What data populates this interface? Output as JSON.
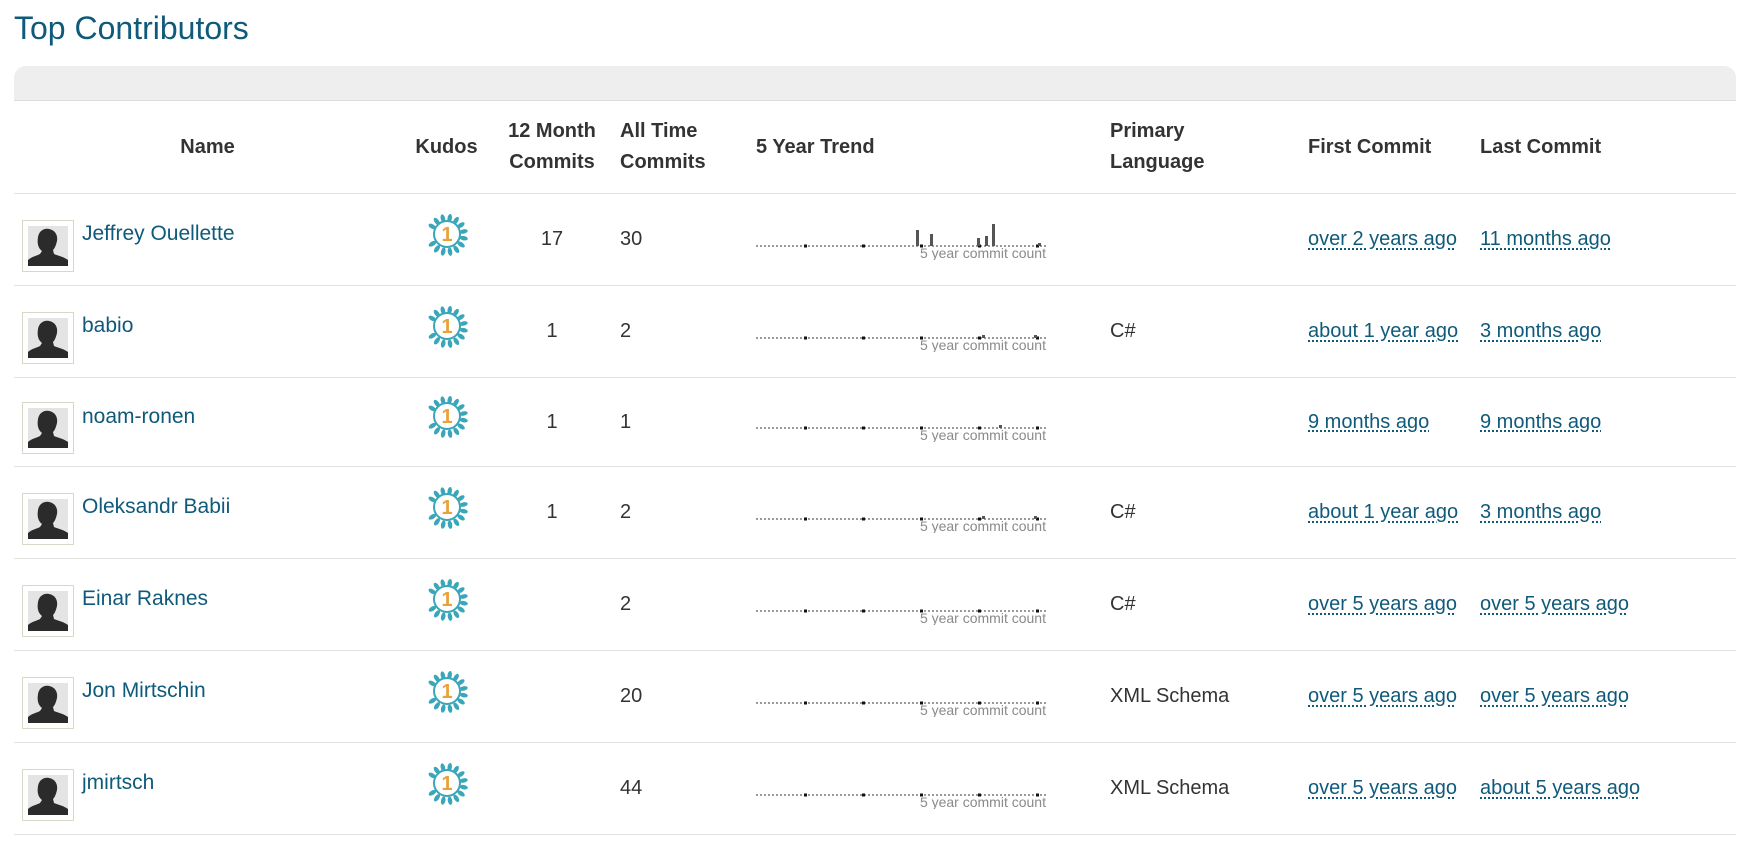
{
  "title": "Top Contributors",
  "columns": {
    "name": "Name",
    "kudos": "Kudos",
    "m12_line1": "12 Month",
    "m12_line2": "Commits",
    "all_line1": "All Time",
    "all_line2": "Commits",
    "trend": "5 Year Trend",
    "lang_line1": "Primary",
    "lang_line2": "Language",
    "first": "First Commit",
    "last": "Last Commit"
  },
  "spark_caption": "5 year commit count",
  "kudo_rank": "1",
  "colors": {
    "title": "#0f5a7a",
    "link": "#0f5a7a",
    "kudo_badge": "#3aa6b9",
    "kudo_number": "#e8a23a"
  },
  "rows": [
    {
      "name": "Jeffrey Ouellette",
      "commits_12m": "17",
      "commits_all": "30",
      "language": "",
      "first_commit": "over 2 years ago",
      "last_commit": "11 months ago"
    },
    {
      "name": "babio",
      "commits_12m": "1",
      "commits_all": "2",
      "language": "C#",
      "first_commit": "about 1 year ago",
      "last_commit": "3 months ago"
    },
    {
      "name": "noam-ronen",
      "commits_12m": "1",
      "commits_all": "1",
      "language": "",
      "first_commit": "9 months ago",
      "last_commit": "9 months ago"
    },
    {
      "name": "Oleksandr Babii",
      "commits_12m": "1",
      "commits_all": "2",
      "language": "C#",
      "first_commit": "about 1 year ago",
      "last_commit": "3 months ago"
    },
    {
      "name": "Einar Raknes",
      "commits_12m": "",
      "commits_all": "2",
      "language": "C#",
      "first_commit": "over 5 years ago",
      "last_commit": "over 5 years ago"
    },
    {
      "name": "Jon Mirtschin",
      "commits_12m": "",
      "commits_all": "20",
      "language": "XML Schema",
      "first_commit": "over 5 years ago",
      "last_commit": "over 5 years ago"
    },
    {
      "name": "jmirtsch",
      "commits_12m": "",
      "commits_all": "44",
      "language": "XML Schema",
      "first_commit": "over 5 years ago",
      "last_commit": "about 5 years ago"
    }
  ]
}
